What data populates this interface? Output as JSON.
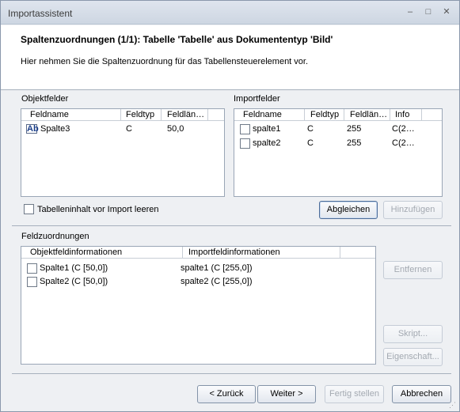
{
  "window": {
    "title": "Importassistent",
    "minimize_glyph": "–",
    "maximize_glyph": "□",
    "close_glyph": "✕"
  },
  "header": {
    "title": "Spaltenzuordnungen (1/1): Tabelle 'Tabelle' aus Dokumententyp 'Bild'",
    "description": "Hier nehmen Sie die Spaltenzuordnung für das Tabellensteuerelement vor."
  },
  "objektfelder": {
    "label": "Objektfelder",
    "columns": [
      "Feldname",
      "Feldtyp",
      "Feldlän…"
    ],
    "rows": [
      {
        "icon": "Ab",
        "name": "Spalte3",
        "type": "C",
        "length": "50,0"
      }
    ]
  },
  "importfelder": {
    "label": "Importfelder",
    "columns": [
      "Feldname",
      "Feldtyp",
      "Feldlän…",
      "Info"
    ],
    "rows": [
      {
        "name": "spalte1",
        "type": "C",
        "length": "255",
        "info": "C(2…"
      },
      {
        "name": "spalte2",
        "type": "C",
        "length": "255",
        "info": "C(2…"
      }
    ]
  },
  "clear_checkbox_label": "Tabelleninhalt vor Import leeren",
  "buttons": {
    "abgleichen": "Abgleichen",
    "hinzufuegen": "Hinzufügen",
    "entfernen": "Entfernen",
    "skript": "Skript...",
    "eigenschaft": "Eigenschaft...",
    "zurueck": "< Zurück",
    "weiter": "Weiter >",
    "fertig": "Fertig stellen",
    "abbrechen": "Abbrechen"
  },
  "feldzuordnungen": {
    "label": "Feldzuordnungen",
    "columns": [
      "Objektfeldinformationen",
      "Importfeldinformationen"
    ],
    "rows": [
      {
        "object": "Spalte1 (C [50,0])",
        "import": "spalte1 (C [255,0])"
      },
      {
        "object": "Spalte2 (C [50,0])",
        "import": "spalte2 (C [255,0])"
      }
    ]
  }
}
